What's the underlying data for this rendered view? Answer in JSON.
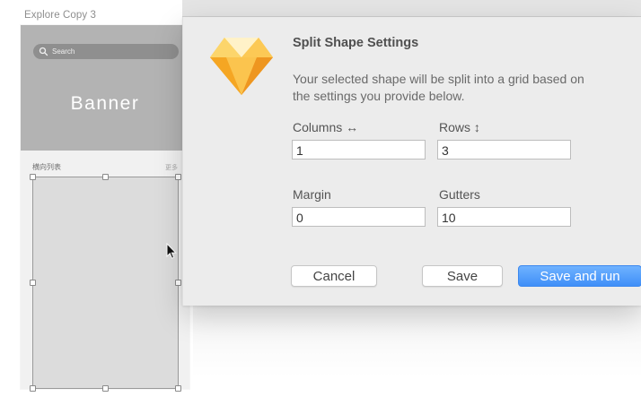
{
  "artboard": {
    "title": "Explore Copy 3",
    "search_placeholder": "Search",
    "banner_text": "Banner",
    "section_label": "横向列表",
    "section_more": "更多"
  },
  "dialog": {
    "title": "Split Shape Settings",
    "description": "Your selected shape will be split into a grid based on the settings you provide below.",
    "fields": {
      "columns": {
        "label": "Columns ↔",
        "value": "1"
      },
      "rows": {
        "label": "Rows ↕",
        "value": "3"
      },
      "margin": {
        "label": "Margin",
        "value": "0"
      },
      "gutters": {
        "label": "Gutters",
        "value": "10"
      }
    },
    "buttons": {
      "cancel": "Cancel",
      "save": "Save",
      "save_and_run": "Save and run"
    }
  },
  "icons": {
    "app": "sketch-diamond-icon",
    "search": "search-icon",
    "cursor": "mouse-pointer-icon"
  },
  "colors": {
    "primary_button": "#4a95fa",
    "dialog_background": "#ececec",
    "banner_background": "#b3b3b3"
  }
}
